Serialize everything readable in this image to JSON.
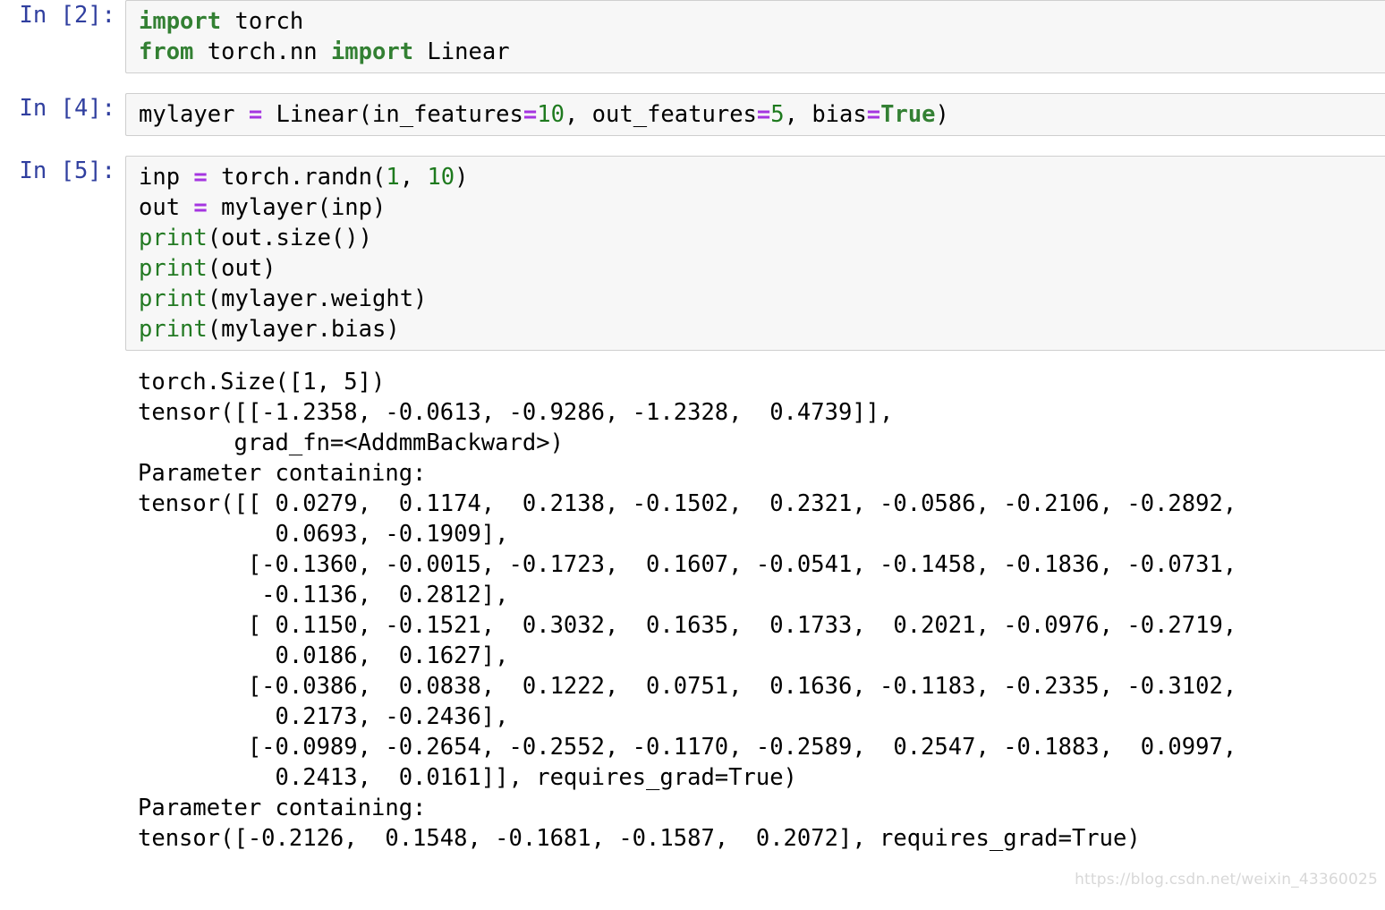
{
  "notebook": {
    "cells": [
      {
        "prompt": "In [2]:",
        "type": "code",
        "code_lines": [
          [
            {
              "t": "import",
              "c": "kw"
            },
            {
              "t": " torch",
              "c": "plain"
            }
          ],
          [
            {
              "t": "from",
              "c": "kw"
            },
            {
              "t": " torch.nn ",
              "c": "plain"
            },
            {
              "t": "import",
              "c": "kw"
            },
            {
              "t": " Linear",
              "c": "plain"
            }
          ]
        ]
      },
      {
        "prompt": "In [4]:",
        "type": "code",
        "code_lines": [
          [
            {
              "t": "mylayer ",
              "c": "plain"
            },
            {
              "t": "=",
              "c": "op"
            },
            {
              "t": " Linear(in_features",
              "c": "plain"
            },
            {
              "t": "=",
              "c": "op"
            },
            {
              "t": "10",
              "c": "num"
            },
            {
              "t": ", out_features",
              "c": "plain"
            },
            {
              "t": "=",
              "c": "op"
            },
            {
              "t": "5",
              "c": "num"
            },
            {
              "t": ", bias",
              "c": "plain"
            },
            {
              "t": "=",
              "c": "op"
            },
            {
              "t": "True",
              "c": "kw"
            },
            {
              "t": ")",
              "c": "plain"
            }
          ]
        ]
      },
      {
        "prompt": "In [5]:",
        "type": "code",
        "code_lines": [
          [
            {
              "t": "inp ",
              "c": "plain"
            },
            {
              "t": "=",
              "c": "op"
            },
            {
              "t": " torch.randn(",
              "c": "plain"
            },
            {
              "t": "1",
              "c": "num"
            },
            {
              "t": ", ",
              "c": "plain"
            },
            {
              "t": "10",
              "c": "num"
            },
            {
              "t": ")",
              "c": "plain"
            }
          ],
          [
            {
              "t": "out ",
              "c": "plain"
            },
            {
              "t": "=",
              "c": "op"
            },
            {
              "t": " mylayer(inp)",
              "c": "plain"
            }
          ],
          [
            {
              "t": "print",
              "c": "bi"
            },
            {
              "t": "(out.size())",
              "c": "plain"
            }
          ],
          [
            {
              "t": "print",
              "c": "bi"
            },
            {
              "t": "(out)",
              "c": "plain"
            }
          ],
          [
            {
              "t": "print",
              "c": "bi"
            },
            {
              "t": "(mylayer.weight)",
              "c": "plain"
            }
          ],
          [
            {
              "t": "print",
              "c": "bi"
            },
            {
              "t": "(mylayer.bias)",
              "c": "plain"
            }
          ]
        ],
        "output_text": "torch.Size([1, 5])\ntensor([[-1.2358, -0.0613, -0.9286, -1.2328,  0.4739]],\n       grad_fn=<AddmmBackward>)\nParameter containing:\ntensor([[ 0.0279,  0.1174,  0.2138, -0.1502,  0.2321, -0.0586, -0.2106, -0.2892,\n          0.0693, -0.1909],\n        [-0.1360, -0.0015, -0.1723,  0.1607, -0.0541, -0.1458, -0.1836, -0.0731,\n         -0.1136,  0.2812],\n        [ 0.1150, -0.1521,  0.3032,  0.1635,  0.1733,  0.2021, -0.0976, -0.2719,\n          0.0186,  0.1627],\n        [-0.0386,  0.0838,  0.1222,  0.0751,  0.1636, -0.1183, -0.2335, -0.3102,\n          0.2173, -0.2436],\n        [-0.0989, -0.2654, -0.2552, -0.1170, -0.2589,  0.2547, -0.1883,  0.0997,\n          0.2413,  0.0161]], requires_grad=True)\nParameter containing:\ntensor([-0.2126,  0.1548, -0.1681, -0.1587,  0.2072], requires_grad=True)"
      }
    ]
  },
  "watermark": {
    "text": "https://blog.csdn.net/weixin_43360025"
  },
  "colors": {
    "keyword": "#338033",
    "builtin": "#237a23",
    "number": "#1e7a1e",
    "operator": "#a535e0",
    "prompt": "#303f9f",
    "cell_background": "#f7f7f7",
    "cell_border": "#cfcfcf",
    "page_background": "#ffffff"
  }
}
